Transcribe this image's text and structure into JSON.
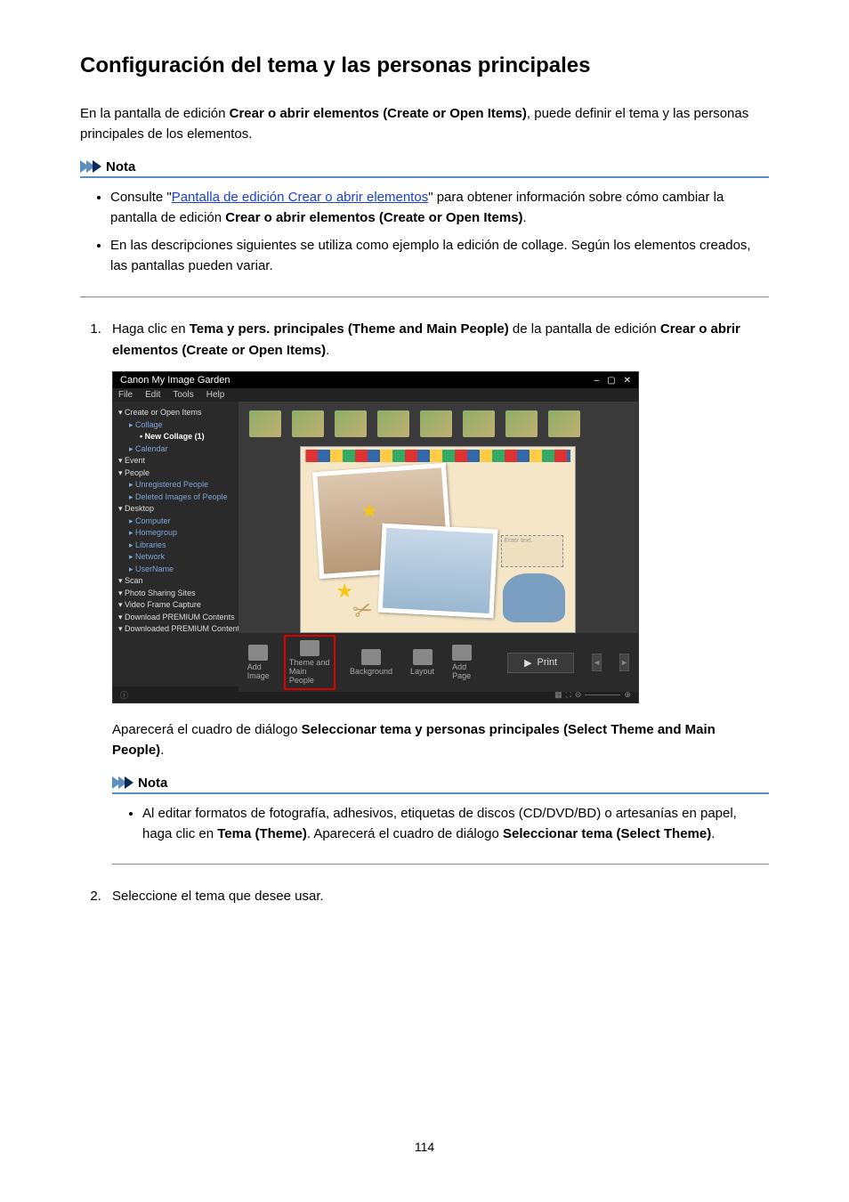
{
  "page_number": "114",
  "title": "Configuración del tema y las personas principales",
  "intro": {
    "prefix": "En la pantalla de edición ",
    "bold": "Crear o abrir elementos (Create or Open Items)",
    "suffix": ", puede definir el tema y las personas principales de los elementos."
  },
  "note1": {
    "heading": "Nota",
    "item1": {
      "prefix": "Consulte \"",
      "link": "Pantalla de edición Crear o abrir elementos",
      "mid": "\" para obtener información sobre cómo cambiar la pantalla de edición ",
      "bold": "Crear o abrir elementos (Create or Open Items)",
      "suffix": "."
    },
    "item2": "En las descripciones siguientes se utiliza como ejemplo la edición de collage. Según los elementos creados, las pantallas pueden variar."
  },
  "step1": {
    "prefix": "Haga clic en ",
    "bold1": "Tema y pers. principales (Theme and Main People)",
    "mid": " de la pantalla de edición ",
    "bold2": "Crear o abrir elementos (Create or Open Items)",
    "suffix": "."
  },
  "screenshot": {
    "title": "Canon My Image Garden",
    "menu": [
      "File",
      "Edit",
      "Tools",
      "Help"
    ],
    "sidebar": [
      {
        "label": "Create or Open Items",
        "cls": "lvl0"
      },
      {
        "label": "Collage",
        "cls": "lvl1"
      },
      {
        "label": "New Collage (1)",
        "cls": "lvl2 sel"
      },
      {
        "label": "Calendar",
        "cls": "lvl1"
      },
      {
        "label": "Event",
        "cls": "lvl0"
      },
      {
        "label": "People",
        "cls": "lvl0"
      },
      {
        "label": "Unregistered People",
        "cls": "lvl1"
      },
      {
        "label": "Deleted Images of People",
        "cls": "lvl1"
      },
      {
        "label": "Desktop",
        "cls": "lvl0"
      },
      {
        "label": "Computer",
        "cls": "lvl1"
      },
      {
        "label": "Homegroup",
        "cls": "lvl1"
      },
      {
        "label": "Libraries",
        "cls": "lvl1"
      },
      {
        "label": "Network",
        "cls": "lvl1"
      },
      {
        "label": "UserName",
        "cls": "lvl1"
      },
      {
        "label": "Scan",
        "cls": "lvl0"
      },
      {
        "label": "Photo Sharing Sites",
        "cls": "lvl0"
      },
      {
        "label": "Video Frame Capture",
        "cls": "lvl0"
      },
      {
        "label": "Download PREMIUM Contents",
        "cls": "lvl0"
      },
      {
        "label": "Downloaded PREMIUM Contents",
        "cls": "lvl0"
      }
    ],
    "textbox": "Enter text.",
    "toolbar": {
      "add_image": "Add Image",
      "theme": "Theme and Main People",
      "background": "Background",
      "layout": "Layout",
      "add_page": "Add Page",
      "print": "Print"
    }
  },
  "after_screenshot": {
    "prefix": "Aparecerá el cuadro de diálogo ",
    "bold": "Seleccionar tema y personas principales (Select Theme and Main People)",
    "suffix": "."
  },
  "note2": {
    "heading": "Nota",
    "item1": {
      "prefix": "Al editar formatos de fotografía, adhesivos, etiquetas de discos (CD/DVD/BD) o artesanías en papel, haga clic en ",
      "bold1": "Tema (Theme)",
      "mid": ". Aparecerá el cuadro de diálogo ",
      "bold2": "Seleccionar tema (Select Theme)",
      "suffix": "."
    }
  },
  "step2": "Seleccione el tema que desee usar."
}
